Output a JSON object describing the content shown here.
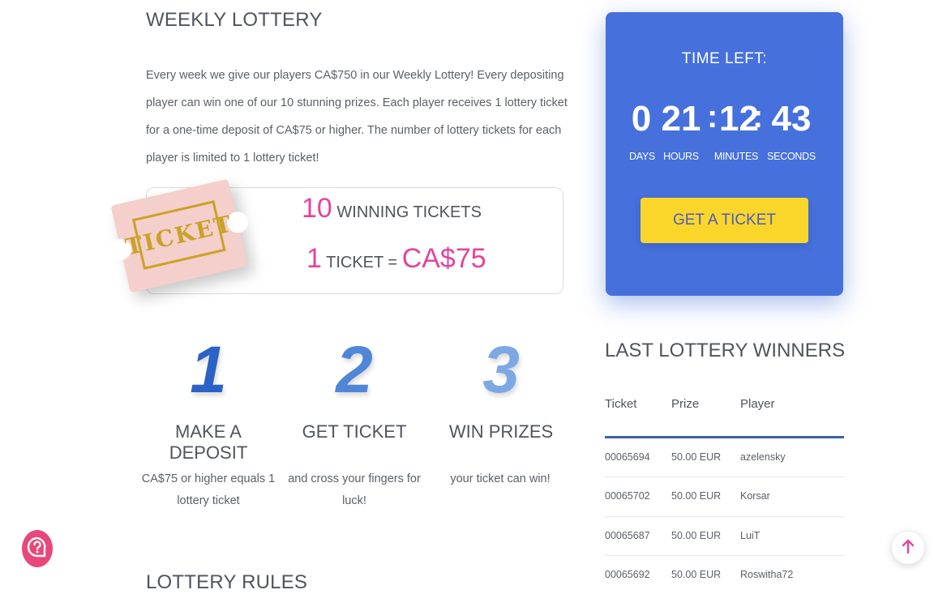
{
  "page": {
    "weekly_title": "WEEKLY LOTTERY",
    "intro": "Every week we give our players CA$750 in our Weekly Lottery! Every depositing player can win one of our 10 stunning prizes. Each player receives 1 lottery ticket for a one-time deposit of CA$75 or higher. The number of lottery tickets for each player is limited to 1 lottery ticket!",
    "rules_title": "LOTTERY RULES"
  },
  "ticket_box": {
    "winning_count": "10",
    "winning_label": "WINNING TICKETS",
    "ticket_count": "1",
    "ticket_label": "TICKET =",
    "ticket_price": "CA$75",
    "image_text": "TICKET"
  },
  "timer": {
    "label": "TIME LEFT:",
    "days": "0",
    "hours": "21",
    "minutes": "12",
    "seconds": "43",
    "colon": ":",
    "days_label": "DAYS",
    "hours_label": "HOURS",
    "minutes_label": "MINUTES",
    "seconds_label": "SECONDS",
    "button_label": "GET A TICKET"
  },
  "steps": [
    {
      "number": "1",
      "title": "MAKE A DEPOSIT",
      "desc": "CA$75 or higher equals 1 lottery ticket",
      "color": "#2b62c6"
    },
    {
      "number": "2",
      "title": "GET TICKET",
      "desc": "and cross your fingers for luck!",
      "color": "#4f86d8"
    },
    {
      "number": "3",
      "title": "WIN PRIZES",
      "desc": "your ticket can win!",
      "color": "#7ea8e4"
    }
  ],
  "winners": {
    "title": "LAST LOTTERY WINNERS",
    "headers": {
      "ticket": "Ticket",
      "prize": "Prize",
      "player": "Player"
    },
    "rows": [
      {
        "ticket": "00065694",
        "prize": "50.00 EUR",
        "player": "azelensky"
      },
      {
        "ticket": "00065702",
        "prize": "50.00 EUR",
        "player": "Korsar"
      },
      {
        "ticket": "00065687",
        "prize": "50.00 EUR",
        "player": "LuiT"
      },
      {
        "ticket": "00065692",
        "prize": "50.00 EUR",
        "player": "Roswitha72"
      }
    ]
  },
  "icons": {
    "help": "help-chat-icon",
    "scroll_top": "arrow-up-icon"
  },
  "colors": {
    "accent_pink": "#e4449a",
    "timer_blue": "#4670dc",
    "button_yellow": "#fbd62a"
  }
}
